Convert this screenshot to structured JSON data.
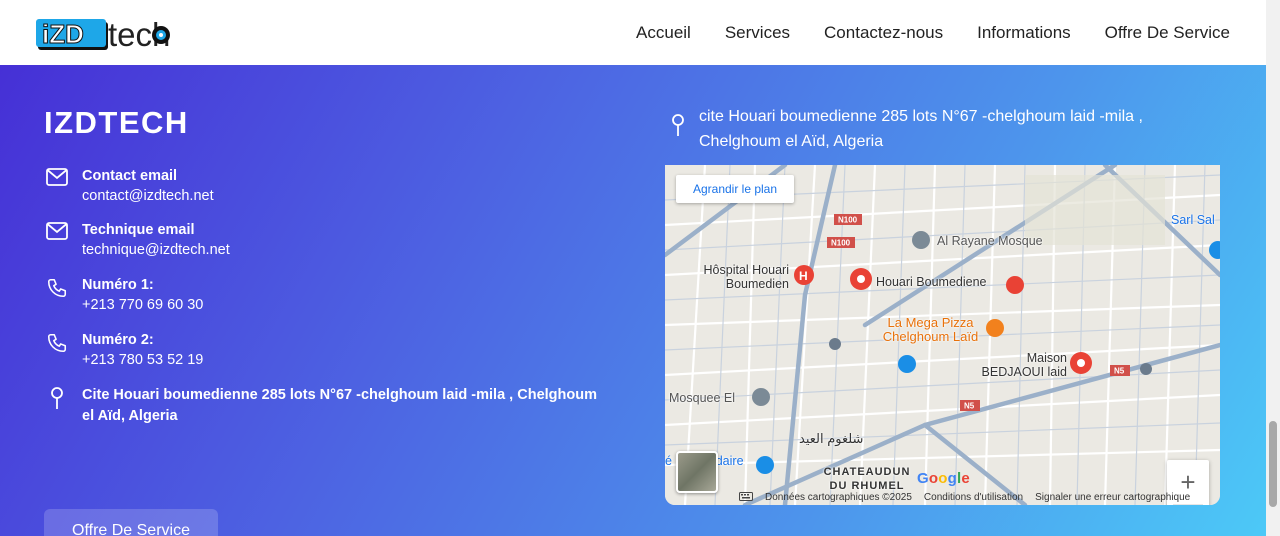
{
  "header": {
    "logo_alt": "iZDtech",
    "nav": [
      "Accueil",
      "Services",
      "Contactez-nous",
      "Informations",
      "Offre De Service"
    ]
  },
  "brand": {
    "title": "IZDTECH"
  },
  "contacts": [
    {
      "icon": "mail-icon",
      "label": "Contact email",
      "value": "contact@izdtech.net"
    },
    {
      "icon": "mail-icon",
      "label": "Technique email",
      "value": "technique@izdtech.net"
    },
    {
      "icon": "phone-icon",
      "label": "Numéro 1:",
      "value": "+213 770 69 60 30"
    },
    {
      "icon": "phone-icon",
      "label": "Numéro 2:",
      "value": "+213 780 53 52 19"
    }
  ],
  "address": "Cite Houari boumedienne 285 lots N°67 -chelghoum laid -mila , Chelghoum el Aïd, Algeria",
  "cta": "Offre De Service",
  "map": {
    "header_address": "cite Houari boumedienne 285 lots N°67 -chelghoum laid -mila , Chelghoum el Aïd, Algeria",
    "enlarge": "Agrandir le plan",
    "pois": {
      "hospital": "Hôspital Houari Boumedien",
      "mosque1": "Al Rayane Mosque",
      "houari": "Houari Boumediene",
      "pizza": "La Mega Pizza Chelghoum Laïd",
      "maison": "Maison BEDJAOUI laid",
      "mosque2": "Mosquee El",
      "sarl": "Sarl Sal",
      "mobile": "é Mobile daire",
      "arabic": "شلغوم العيد",
      "chateaudun": "CHATEAUDUN DU RHUMEL"
    },
    "roads": [
      "N100",
      "N100",
      "N5",
      "N5"
    ],
    "zoom_in": "+",
    "zoom_out": "−",
    "google": "Google",
    "attribution": [
      "Données cartographiques ©2025",
      "Conditions d'utilisation",
      "Signaler une erreur cartographique"
    ]
  }
}
